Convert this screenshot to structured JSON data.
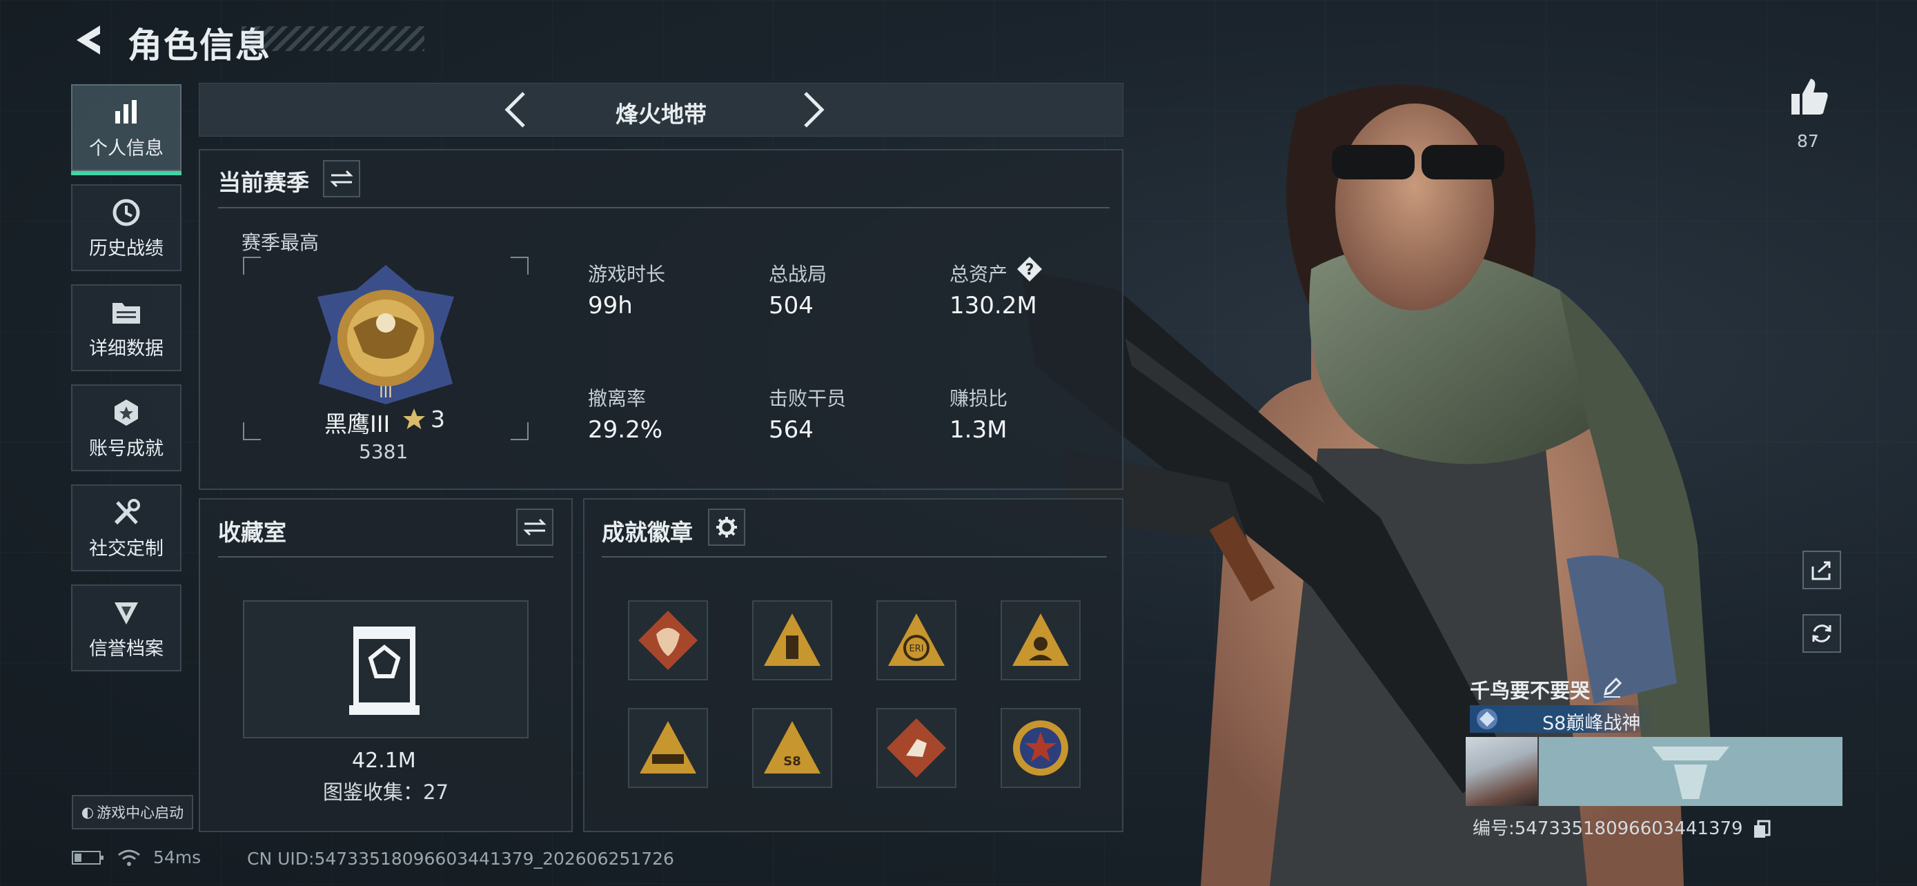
{
  "header": {
    "title": "角色信息"
  },
  "sidebar": {
    "items": [
      {
        "label": "个人信息",
        "icon": "bar-chart-icon",
        "active": true
      },
      {
        "label": "历史战绩",
        "icon": "history-clock-icon",
        "active": false
      },
      {
        "label": "详细数据",
        "icon": "folder-icon",
        "active": false
      },
      {
        "label": "账号成就",
        "icon": "achievement-medal-icon",
        "active": false
      },
      {
        "label": "社交定制",
        "icon": "tools-icon",
        "active": false
      },
      {
        "label": "信誉档案",
        "icon": "credit-shield-icon",
        "active": false
      }
    ],
    "game_center": "游戏中心启动"
  },
  "mode": {
    "label": "烽火地带"
  },
  "season": {
    "title": "当前赛季",
    "best_label": "赛季最高",
    "rank_name": "黑鹰III",
    "rank_level": "3",
    "rank_score": "5381",
    "stats": [
      {
        "label": "游戏时长",
        "value": "99h"
      },
      {
        "label": "总战局",
        "value": "504"
      },
      {
        "label": "总资产",
        "value": "130.2M"
      },
      {
        "label": "撤离率",
        "value": "29.2%"
      },
      {
        "label": "击败干员",
        "value": "564"
      },
      {
        "label": "赚损比",
        "value": "1.3M"
      }
    ],
    "help_glyph": "?"
  },
  "collection": {
    "title": "收藏室",
    "value": "42.1M",
    "count": "图鉴收集：27"
  },
  "badges": {
    "title": "成就徽章",
    "items": [
      {
        "name": "dragon-badge",
        "color": "#a6472c"
      },
      {
        "name": "tower-badge",
        "color": "#c8962e"
      },
      {
        "name": "eri-badge",
        "color": "#c8962e"
      },
      {
        "name": "operator-badge",
        "color": "#c8962e"
      },
      {
        "name": "vehicle-badge",
        "color": "#c8962e"
      },
      {
        "name": "s8-badge",
        "color": "#c8962e"
      },
      {
        "name": "runner-badge",
        "color": "#a6472c"
      },
      {
        "name": "star-emblem-badge",
        "color": "#b03a2a"
      }
    ]
  },
  "status": {
    "ping": "54ms",
    "uid": "CN UID:5473351809660344137​9_202606251726"
  },
  "profile": {
    "likes": "87",
    "name": "千鸟要不要哭",
    "title_tag": "S8巅峰战神",
    "player_id": "编号:5473351809660344137​9"
  },
  "colors": {
    "accent": "#3fd6a5",
    "panel_border": "#3a454e",
    "name_card": "#8fb2ba"
  }
}
